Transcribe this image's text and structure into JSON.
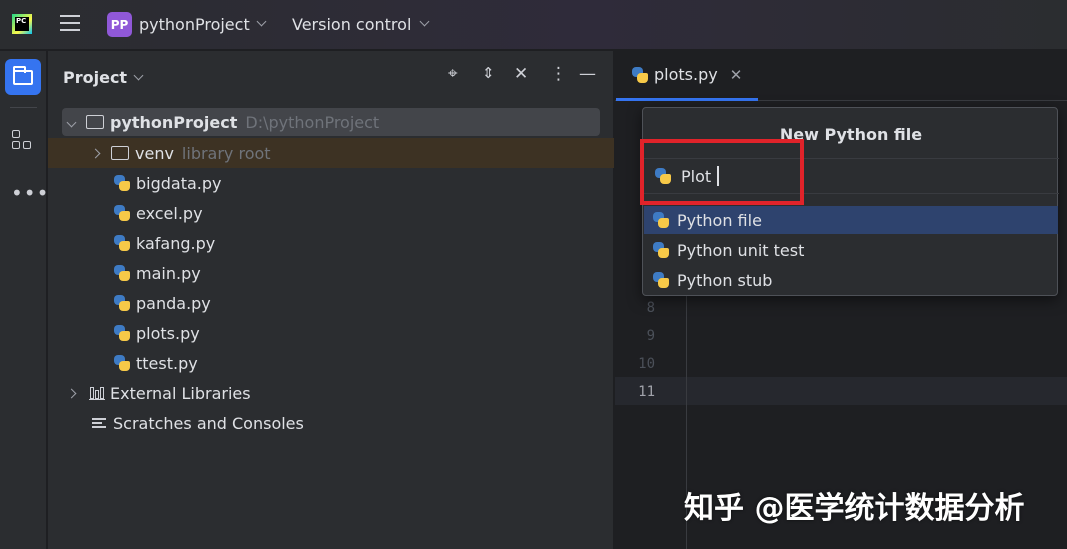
{
  "topbar": {
    "project_badge": "PP",
    "project_name": "pythonProject",
    "version_control_label": "Version control"
  },
  "project_panel": {
    "title": "Project",
    "tree": [
      {
        "label": "pythonProject",
        "hint": "D:\\pythonProject",
        "kind": "root-folder"
      },
      {
        "label": "venv",
        "hint": "library root",
        "kind": "folder"
      },
      {
        "label": "bigdata.py",
        "kind": "python-file"
      },
      {
        "label": "excel.py",
        "kind": "python-file"
      },
      {
        "label": "kafang.py",
        "kind": "python-file"
      },
      {
        "label": "main.py",
        "kind": "python-file"
      },
      {
        "label": "panda.py",
        "kind": "python-file"
      },
      {
        "label": "plots.py",
        "kind": "python-file"
      },
      {
        "label": "ttest.py",
        "kind": "python-file"
      },
      {
        "label": "External Libraries",
        "kind": "libraries"
      },
      {
        "label": "Scratches and Consoles",
        "kind": "scratches"
      }
    ]
  },
  "editor": {
    "tab_label": "plots.py",
    "line_numbers": [
      "8",
      "9",
      "10",
      "11"
    ]
  },
  "popup": {
    "title": "New Python file",
    "input_value": "Plot",
    "options": [
      {
        "label": "Python file",
        "selected": true
      },
      {
        "label": "Python unit test",
        "selected": false
      },
      {
        "label": "Python stub",
        "selected": false
      }
    ]
  },
  "watermark": "知乎 @医学统计数据分析",
  "colors": {
    "accent": "#3574f0",
    "highlight_box": "#e0232a",
    "selection": "#2e436e",
    "project_badge": "#9058d8"
  }
}
